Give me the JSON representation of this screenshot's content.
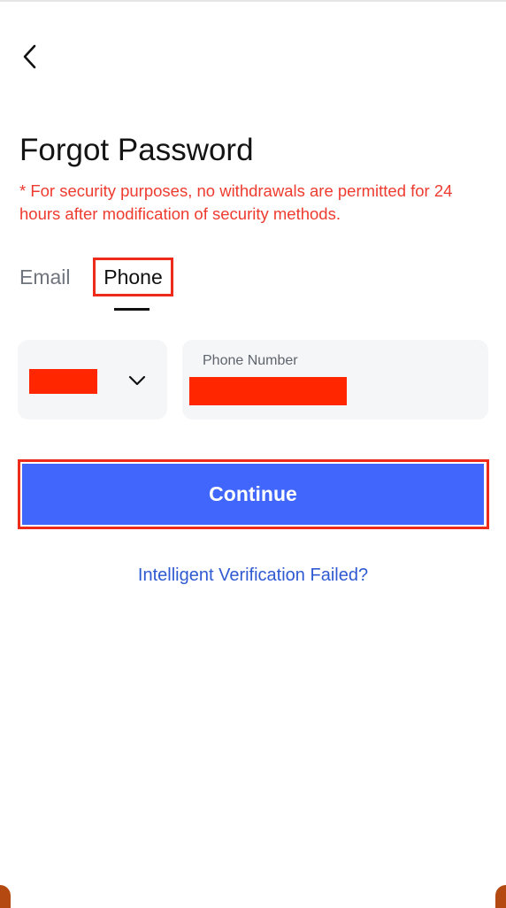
{
  "header": {
    "back_icon": "chevron-left-icon"
  },
  "page": {
    "title": "Forgot Password",
    "notice": "* For security purposes, no withdrawals are permitted for 24 hours after modification of security methods.",
    "notice_color": "#ee3b2f"
  },
  "tabs": {
    "items": [
      {
        "label": "Email",
        "active": false
      },
      {
        "label": "Phone",
        "active": true
      }
    ]
  },
  "form": {
    "country_code": {
      "value_redacted": true,
      "dropdown_icon": "chevron-down-icon"
    },
    "phone": {
      "label": "Phone Number",
      "value_redacted": true
    },
    "redaction_color": "#ff2600"
  },
  "actions": {
    "continue_label": "Continue",
    "continue_color": "#4066fb",
    "highlight_color": "#ee2a1b",
    "verification_link": "Intelligent Verification Failed?",
    "link_color": "#2f5ad1"
  }
}
